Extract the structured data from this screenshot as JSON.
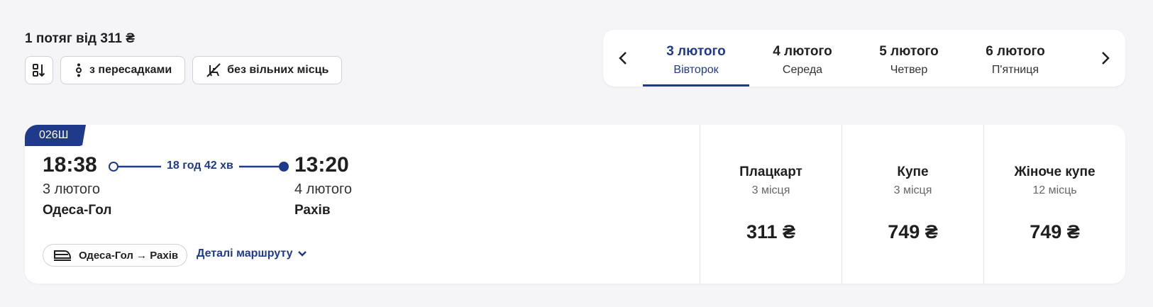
{
  "summary": "1 потяг від 311 ₴",
  "filters": {
    "transfers_label": "з пересадками",
    "no_seats_label": "без вільних місць"
  },
  "dates": [
    {
      "date": "3 лютого",
      "weekday": "Вівторок",
      "active": true
    },
    {
      "date": "4 лютого",
      "weekday": "Середа"
    },
    {
      "date": "5 лютого",
      "weekday": "Четвер"
    },
    {
      "date": "6 лютого",
      "weekday": "П'ятниця"
    }
  ],
  "train": {
    "number": "026Ш",
    "departure": {
      "time": "18:38",
      "date": "3 лютого",
      "station": "Одеса-Гол"
    },
    "arrival": {
      "time": "13:20",
      "date": "4 лютого",
      "station": "Рахів"
    },
    "duration": "18 год 42 хв",
    "route": "Одеса-Гол → Рахів",
    "details_label": "Деталі маршруту",
    "classes": [
      {
        "name": "Плацкарт",
        "seats": "3 місця",
        "price": "311 ₴"
      },
      {
        "name": "Купе",
        "seats": "3 місця",
        "price": "749 ₴"
      },
      {
        "name": "Жіноче купе",
        "seats": "12 місць",
        "price": "749 ₴"
      }
    ]
  },
  "colors": {
    "accent": "#1f3a8a",
    "background": "#f5f5f7"
  }
}
